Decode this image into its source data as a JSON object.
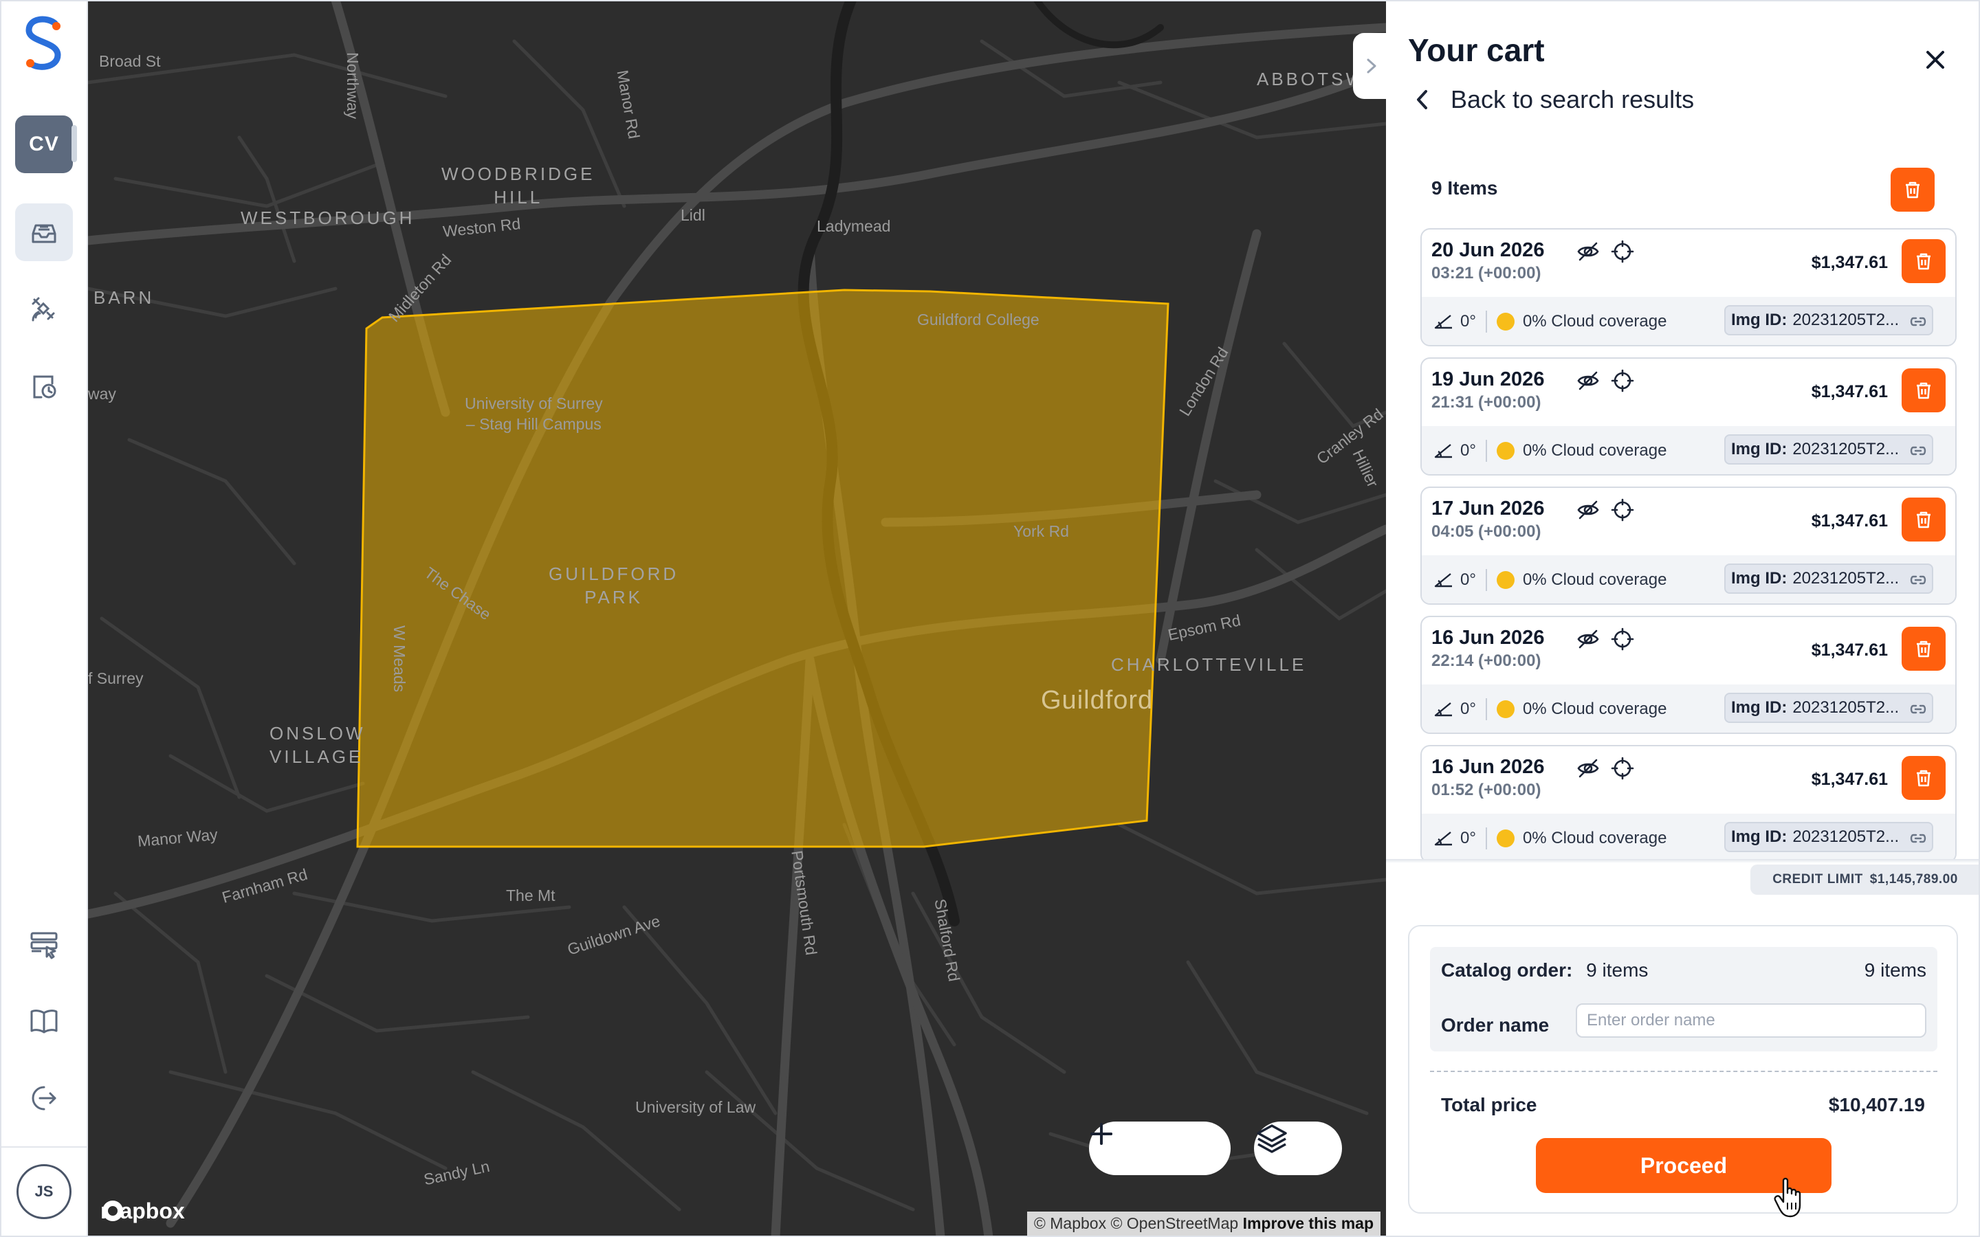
{
  "rail": {
    "org_badge": "CV",
    "user_initials": "JS",
    "items": [
      {
        "name": "orders",
        "icon": "inbox-tray-icon",
        "active": true
      },
      {
        "name": "satellite",
        "icon": "satellite-icon",
        "active": false
      },
      {
        "name": "history",
        "icon": "clock-history-icon",
        "active": false
      },
      {
        "name": "tasks",
        "icon": "server-cursor-icon",
        "active": false
      },
      {
        "name": "docs",
        "icon": "book-icon",
        "active": false
      },
      {
        "name": "logout",
        "icon": "logout-icon",
        "active": false
      }
    ]
  },
  "map": {
    "labels": {
      "broad_st": "Broad St",
      "northway": "Northway",
      "manor_rd": "Manor Rd",
      "woodbridge_hill": "WOODBRIDGE\nHILL",
      "westborough": "WESTBOROUGH",
      "weston_rd": "Weston Rd",
      "lidl": "Lidl",
      "ladymead": "Ladymead",
      "abbotswood": "ABBOTSW",
      "barn": "BARN",
      "midleton_rd": "Midleton Rd",
      "way": "way",
      "guildford_college": "Guildford College",
      "london_rd": "London Rd",
      "cranley_rd": "Cranley Rd",
      "hillier": "Hillier",
      "university": "University of Surrey\n– Stag Hill Campus",
      "york_rd": "York Rd",
      "the_chase": "The Chase",
      "guildford_park": "GUILDFORD\nPARK",
      "epsom_rd": "Epsom Rd",
      "w_meads": "W Meads",
      "of_surrey": "f Surrey",
      "charlotteville": "CHARLOTTEVILLE",
      "guildford": "Guildford",
      "onslow_village": "ONSLOW\nVILLAGE",
      "manor_way": "Manor Way",
      "farnham_rd": "Farnham Rd",
      "the_mt": "The Mt",
      "guildown_ave": "Guildown Ave",
      "portsmouth_rd": "Portsmouth Rd",
      "shalford_rd": "Shalford Rd",
      "university_of_law": "University of Law",
      "sandy_ln": "Sandy Ln"
    },
    "aoi_color": "#f2b500",
    "controls": {
      "zoom_out": "−",
      "zoom_in": "+"
    },
    "mapbox_logo": "mapbox",
    "attribution": "© Mapbox © OpenStreetMap",
    "improve": "Improve this map"
  },
  "cart": {
    "title": "Your cart",
    "back_label": "Back to search results",
    "items_count_label": "9 Items",
    "items": [
      {
        "date": "20 Jun 2026",
        "time": "03:21 (+00:00)",
        "price": "$1,347.61",
        "angle": "0°",
        "cloud": "0% Cloud coverage",
        "img_id_label": "Img ID:",
        "img_id": "20231205T2..."
      },
      {
        "date": "19 Jun 2026",
        "time": "21:31 (+00:00)",
        "price": "$1,347.61",
        "angle": "0°",
        "cloud": "0% Cloud coverage",
        "img_id_label": "Img ID:",
        "img_id": "20231205T2..."
      },
      {
        "date": "17 Jun 2026",
        "time": "04:05 (+00:00)",
        "price": "$1,347.61",
        "angle": "0°",
        "cloud": "0% Cloud coverage",
        "img_id_label": "Img ID:",
        "img_id": "20231205T2..."
      },
      {
        "date": "16 Jun 2026",
        "time": "22:14 (+00:00)",
        "price": "$1,347.61",
        "angle": "0°",
        "cloud": "0% Cloud coverage",
        "img_id_label": "Img ID:",
        "img_id": "20231205T2..."
      },
      {
        "date": "16 Jun 2026",
        "time": "01:52 (+00:00)",
        "price": "$1,347.61",
        "angle": "0°",
        "cloud": "0% Cloud coverage",
        "img_id_label": "Img ID:",
        "img_id": "20231205T2..."
      }
    ],
    "credit_limit_label": "CREDIT LIMIT",
    "credit_limit_value": "$1,145,789.00",
    "summary": {
      "catalog_label": "Catalog order:",
      "catalog_value": "9 items",
      "catalog_right": "9 items",
      "order_name_label": "Order name",
      "order_name_placeholder": "Enter order name",
      "order_name_value": "",
      "total_label": "Total price",
      "total_value": "$10,407.19",
      "proceed_label": "Proceed"
    },
    "accent_color": "#ff5f0e"
  }
}
